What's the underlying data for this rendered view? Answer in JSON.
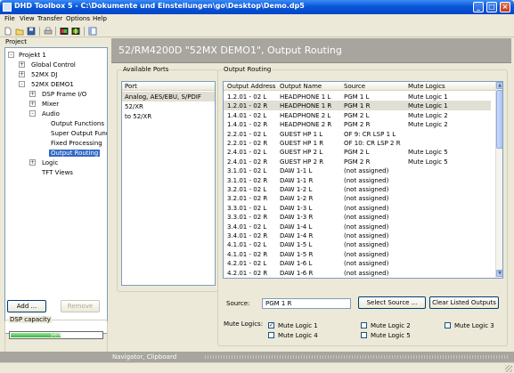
{
  "window": {
    "title": "DHD Toolbox 5 - C:\\Dokumente und Einstellungen\\go\\Desktop\\Demo.dp5",
    "minimize": "_",
    "maximize": "□",
    "close": "×"
  },
  "menu": {
    "items": [
      "File",
      "View",
      "Transfer",
      "Options",
      "Help"
    ]
  },
  "toolbar": {
    "icons": [
      "new-icon",
      "open-icon",
      "save-icon",
      "print-icon",
      "transfer-icon",
      "transfer-settings-icon",
      "view-icon"
    ]
  },
  "project": {
    "label": "Project",
    "tree": [
      {
        "label": "Projekt 1",
        "depth": 0,
        "expander": "-"
      },
      {
        "label": "Global Control",
        "depth": 1,
        "expander": "+"
      },
      {
        "label": "52MX DJ",
        "depth": 1,
        "expander": "+"
      },
      {
        "label": "52MX DEMO1",
        "depth": 1,
        "expander": "-"
      },
      {
        "label": "DSP Frame I/O",
        "depth": 2,
        "expander": "+"
      },
      {
        "label": "Mixer",
        "depth": 2,
        "expander": "+"
      },
      {
        "label": "Audio",
        "depth": 2,
        "expander": "-"
      },
      {
        "label": "Output Functions",
        "depth": 3,
        "expander": ""
      },
      {
        "label": "Super Output Functions",
        "depth": 3,
        "expander": ""
      },
      {
        "label": "Fixed Processing",
        "depth": 3,
        "expander": ""
      },
      {
        "label": "Output Routing",
        "depth": 3,
        "expander": "",
        "selected": true
      },
      {
        "label": "Logic",
        "depth": 2,
        "expander": "+"
      },
      {
        "label": "TFT Views",
        "depth": 2,
        "expander": ""
      }
    ],
    "add_label": "Add ...",
    "remove_label": "Remove"
  },
  "dsp": {
    "label": "DSP capacity",
    "percent_text": "56%",
    "fraction": 0.56
  },
  "header": {
    "title": "52/RM4200D \"52MX DEMO1\", Output Routing"
  },
  "available_ports": {
    "label": "Available Ports",
    "column": "Port",
    "items": [
      {
        "label": "Analog, AES/EBU, S/PDIF",
        "selected": true
      },
      {
        "label": "52/XR",
        "selected": false
      },
      {
        "label": "to 52/XR",
        "selected": false
      }
    ]
  },
  "output_routing": {
    "label": "Output Routing",
    "columns": [
      "Output Address",
      "Output Name",
      "Source",
      "Mute Logics"
    ],
    "rows": [
      {
        "address": "1.2.01 - 02 L",
        "name": "HEADPHONE 1 L",
        "source": "PGM 1 L",
        "mute": "Mute Logic 1",
        "selected": false
      },
      {
        "address": "1.2.01 - 02 R",
        "name": "HEADPHONE 1 R",
        "source": "PGM 1 R",
        "mute": "Mute Logic 1",
        "selected": true
      },
      {
        "address": "1.4.01 - 02 L",
        "name": "HEADPHONE 2 L",
        "source": "PGM 2 L",
        "mute": "Mute Logic 2",
        "selected": false
      },
      {
        "address": "1.4.01 - 02 R",
        "name": "HEADPHONE 2 R",
        "source": "PGM 2 R",
        "mute": "Mute Logic 2",
        "selected": false
      },
      {
        "address": "2.2.01 - 02 L",
        "name": "GUEST HP 1 L",
        "source": "OF 9: CR LSP 1 L",
        "mute": "",
        "selected": false
      },
      {
        "address": "2.2.01 - 02 R",
        "name": "GUEST HP 1 R",
        "source": "OF 10: CR LSP 2 R",
        "mute": "",
        "selected": false
      },
      {
        "address": "2.4.01 - 02 L",
        "name": "GUEST HP 2 L",
        "source": "PGM 2 L",
        "mute": "Mute Logic 5",
        "selected": false
      },
      {
        "address": "2.4.01 - 02 R",
        "name": "GUEST HP 2 R",
        "source": "PGM 2 R",
        "mute": "Mute Logic 5",
        "selected": false
      },
      {
        "address": "3.1.01 - 02 L",
        "name": "DAW 1-1 L",
        "source": "(not assigned)",
        "mute": "",
        "selected": false
      },
      {
        "address": "3.1.01 - 02 R",
        "name": "DAW 1-1 R",
        "source": "(not assigned)",
        "mute": "",
        "selected": false
      },
      {
        "address": "3.2.01 - 02 L",
        "name": "DAW 1-2 L",
        "source": "(not assigned)",
        "mute": "",
        "selected": false
      },
      {
        "address": "3.2.01 - 02 R",
        "name": "DAW 1-2 R",
        "source": "(not assigned)",
        "mute": "",
        "selected": false
      },
      {
        "address": "3.3.01 - 02 L",
        "name": "DAW 1-3 L",
        "source": "(not assigned)",
        "mute": "",
        "selected": false
      },
      {
        "address": "3.3.01 - 02 R",
        "name": "DAW 1-3 R",
        "source": "(not assigned)",
        "mute": "",
        "selected": false
      },
      {
        "address": "3.4.01 - 02 L",
        "name": "DAW 1-4 L",
        "source": "(not assigned)",
        "mute": "",
        "selected": false
      },
      {
        "address": "3.4.01 - 02 R",
        "name": "DAW 1-4 R",
        "source": "(not assigned)",
        "mute": "",
        "selected": false
      },
      {
        "address": "4.1.01 - 02 L",
        "name": "DAW 1-5 L",
        "source": "(not assigned)",
        "mute": "",
        "selected": false
      },
      {
        "address": "4.1.01 - 02 R",
        "name": "DAW 1-5 R",
        "source": "(not assigned)",
        "mute": "",
        "selected": false
      },
      {
        "address": "4.2.01 - 02 L",
        "name": "DAW 1-6 L",
        "source": "(not assigned)",
        "mute": "",
        "selected": false
      },
      {
        "address": "4.2.01 - 02 R",
        "name": "DAW 1-6 R",
        "source": "(not assigned)",
        "mute": "",
        "selected": false
      }
    ],
    "source_label": "Source:",
    "source_value": "PGM 1 R",
    "select_source_label": "Select Source ...",
    "clear_label": "Clear Listed Outputs",
    "mute_logics_label": "Mute Logics:",
    "mute_logics": [
      {
        "label": "Mute Logic 1",
        "checked": true
      },
      {
        "label": "Mute Logic 2",
        "checked": false
      },
      {
        "label": "Mute Logic 3",
        "checked": false
      },
      {
        "label": "Mute Logic 4",
        "checked": false
      },
      {
        "label": "Mute Logic 5",
        "checked": false
      }
    ]
  },
  "statusbar": {
    "text": "Navigator, Clipboard"
  }
}
